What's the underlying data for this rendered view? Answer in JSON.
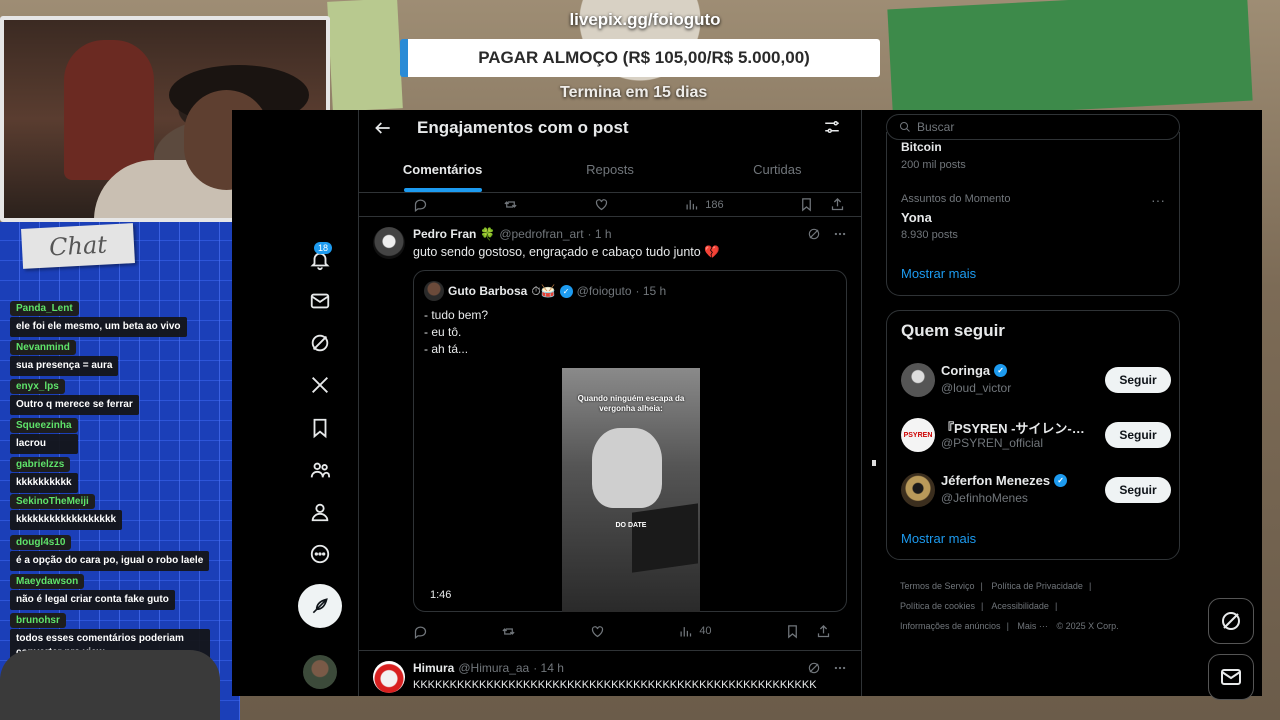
{
  "overlay": {
    "donation_url": "livepix.gg/foioguto",
    "donation_goal": "PAGAR ALMOÇO (R$ 105,00/R$ 5.000,00)",
    "donation_remaining": "Termina em 15 dias",
    "chat_title": "Chat"
  },
  "chat": [
    {
      "user": "Panda_Lent",
      "text": "ele foi ele mesmo, um beta ao vivo"
    },
    {
      "user": "Nevanmind",
      "text": "sua presença = aura"
    },
    {
      "user": "enyx_lps",
      "text": "Outro q merece se ferrar"
    },
    {
      "user": "Squeezinha",
      "text": "lacrou"
    },
    {
      "user": "gabrielzzs",
      "text": "kkkkkkkkkk"
    },
    {
      "user": "SekinoTheMeiji",
      "text": "kkkkkkkkkkkkkkkkkk"
    },
    {
      "user": "dougl4s10",
      "text": "é a opção do cara po, igual o robo laele"
    },
    {
      "user": "Maeydawson",
      "text": "não é legal criar conta fake guto"
    },
    {
      "user": "brunohsr",
      "text": "todos esses comentários poderiam converter pra view"
    }
  ],
  "nav": {
    "notifications_badge": "18"
  },
  "header": {
    "title": "Engajamentos com o post"
  },
  "tabs": [
    "Comentários",
    "Reposts",
    "Curtidas"
  ],
  "top_actions": {
    "views": "186"
  },
  "tweet": {
    "name": "Pedro Fran",
    "emoji": "🍀",
    "handle": "@pedrofran_art",
    "time": "· 1 h",
    "text": "guto sendo gostoso, engraçado e cabaço tudo junto 💔",
    "views": "40",
    "quote": {
      "name": "Guto Barbosa",
      "emojis": "⏱🥁",
      "handle": "@foioguto",
      "time": "· 15 h",
      "lines": [
        "- tudo bem?",
        "- eu tô.",
        "- ah tá..."
      ],
      "video_caption": "Quando ninguém escapa da vergonha alheia:",
      "video_overlay": "DO DATE",
      "video_duration": "1:46"
    }
  },
  "tweet2": {
    "name": "Himura",
    "handle": "@Himura_aa",
    "time": "· 14 h",
    "text": "KKKKKKKKKKKKKKKKKKKKKKKKKKKKKKKKKKKKKKKKKKKKKKKKKKKKKKK"
  },
  "sidebar": {
    "search_placeholder": "Buscar",
    "trend_top_title": "Bitcoin",
    "trend_top_count": "200 mil posts",
    "trend_category": "Assuntos do Momento",
    "trend_name": "Yona",
    "trend_count": "8.930 posts",
    "show_more": "Mostrar mais",
    "who_to_follow": "Quem seguir",
    "follow_button": "Seguir",
    "suggestions": [
      {
        "name": "Coringa",
        "handle": "@loud_victor",
        "verified": true
      },
      {
        "name": "『PSYREN -サイレン-…",
        "handle": "@PSYREN_official",
        "verified": false
      },
      {
        "name": "Jéferfon Menezes",
        "handle": "@JefinhoMenes",
        "verified": true
      }
    ],
    "footer": [
      "Termos de Serviço",
      "|",
      "Política de Privacidade",
      "|",
      "Política de cookies",
      "|",
      "Acessibilidade",
      "|",
      "Informações de anúncios",
      "|",
      "Mais ···",
      "© 2025 X Corp."
    ]
  }
}
